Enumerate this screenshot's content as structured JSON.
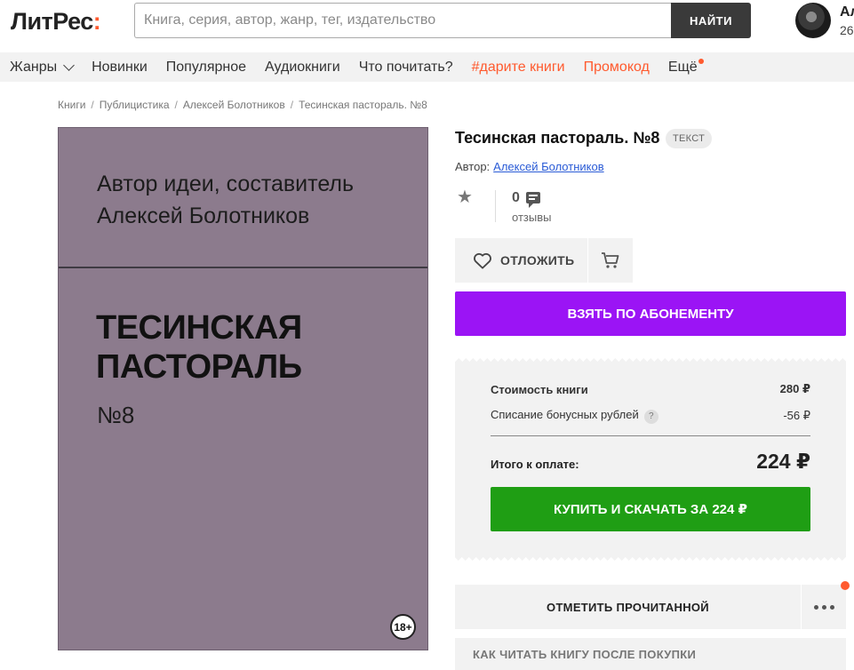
{
  "header": {
    "logo_main": "ЛитРес",
    "logo_accent": ":",
    "search_placeholder": "Книга, серия, автор, жанр, тег, издательство",
    "search_button": "НАЙТИ",
    "user_name": "Ал",
    "user_balance": "26"
  },
  "nav": {
    "items": [
      {
        "label": "Жанры"
      },
      {
        "label": "Новинки"
      },
      {
        "label": "Популярное"
      },
      {
        "label": "Аудиокниги"
      },
      {
        "label": "Что почитать?"
      },
      {
        "label": "#дарите книги"
      },
      {
        "label": "Промокод"
      },
      {
        "label": "Ещё"
      }
    ],
    "accent_color": "#ff5a2e"
  },
  "breadcrumb": {
    "items": [
      "Книги",
      "Публицистика",
      "Алексей Болотников",
      "Тесинская пастораль. №8"
    ],
    "separator": "/"
  },
  "cover": {
    "author_line1": "Автор идеи, составитель",
    "author_line2": "Алексей Болотников",
    "title_line1": "ТЕСИНСКАЯ",
    "title_line2": "ПАСТОРАЛЬ",
    "number": "№8",
    "age_rating": "18+",
    "background_color": "#8c7b8d"
  },
  "book": {
    "title": "Тесинская пастораль. №8",
    "format_badge": "ТЕКСТ",
    "author_label": "Автор:",
    "author_name": "Алексей Болотников",
    "reviews_count": "0",
    "reviews_label": "отзывы"
  },
  "actions": {
    "postpone_label": "ОТЛОЖИТЬ",
    "subscribe_label": "ВЗЯТЬ ПО АБОНЕМЕНТУ",
    "subscribe_color": "#9b14f5",
    "mark_read_label": "ОТМЕТИТЬ ПРОЧИТАННОЙ",
    "how_to_read_label": "КАК ЧИТАТЬ КНИГУ ПОСЛЕ ПОКУПКИ"
  },
  "price": {
    "cost_label": "Стоимость книги",
    "cost_value": "280 ₽",
    "bonus_label": "Списание бонусных рублей",
    "bonus_help": "?",
    "bonus_value": "-56 ₽",
    "total_label": "Итого к оплате:",
    "total_value": "224 ₽",
    "buy_label": "КУПИТЬ И СКАЧАТЬ ЗА 224 ₽",
    "buy_color": "#1f9e14"
  }
}
